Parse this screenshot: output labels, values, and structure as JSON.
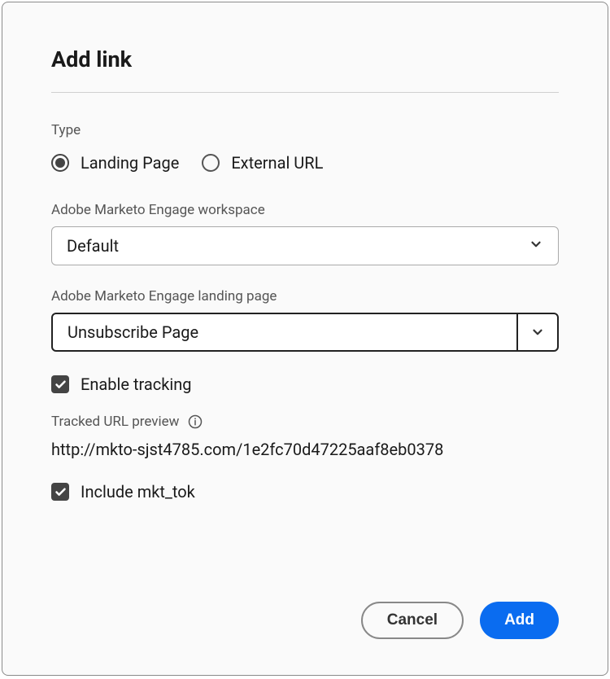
{
  "dialog": {
    "title": "Add link"
  },
  "type": {
    "label": "Type",
    "options": {
      "landing": "Landing Page",
      "external": "External URL"
    }
  },
  "workspace": {
    "label": "Adobe Marketo Engage workspace",
    "value": "Default"
  },
  "landingPage": {
    "label": "Adobe Marketo Engage landing page",
    "value": "Unsubscribe Page"
  },
  "tracking": {
    "enableLabel": "Enable tracking",
    "previewLabel": "Tracked URL preview",
    "previewUrl": "http://mkto-sjst4785.com/1e2fc70d47225aaf8eb0378",
    "includeTokLabel": "Include mkt_tok"
  },
  "footer": {
    "cancel": "Cancel",
    "add": "Add"
  }
}
